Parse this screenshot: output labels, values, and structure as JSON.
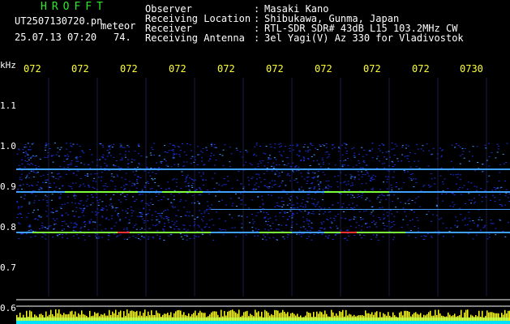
{
  "header": {
    "app_title": "HROFFT",
    "filename": "UT2507130720.pn",
    "meteor_label": "meteor",
    "datetime": "25.07.13 07:20",
    "count": "74.",
    "info": [
      {
        "label": "Observer",
        "value": "Masaki Kano"
      },
      {
        "label": "Receiving Location",
        "value": "Shibukawa, Gunma, Japan"
      },
      {
        "label": "Receiver",
        "value": "RTL-SDR SDR# 43dB L15 103.2MHz CW"
      },
      {
        "label": "Receiving Antenna",
        "value": "3el Yagi(V) Az 330 for Vladivostok"
      }
    ],
    "separator": ":"
  },
  "time_axis": {
    "labels": [
      "072",
      "072",
      "072",
      "072",
      "072",
      "072",
      "072",
      "072",
      "072",
      "0730"
    ]
  },
  "freq_axis": {
    "unit": "kHz",
    "labels": [
      "1.1",
      "1.0",
      "0.9",
      "0.8",
      "0.7",
      "0.6"
    ]
  },
  "colors": {
    "background": "#000000",
    "title": "#2ee82e",
    "time_labels": "#ffff33",
    "noise_low": "#1a2fd6",
    "noise_mid": "#3fa0ff",
    "signal": "#7cff3a",
    "peak": "#ff3030",
    "volume_bar": "#ffff00",
    "volume_base": "#00e0ff"
  }
}
